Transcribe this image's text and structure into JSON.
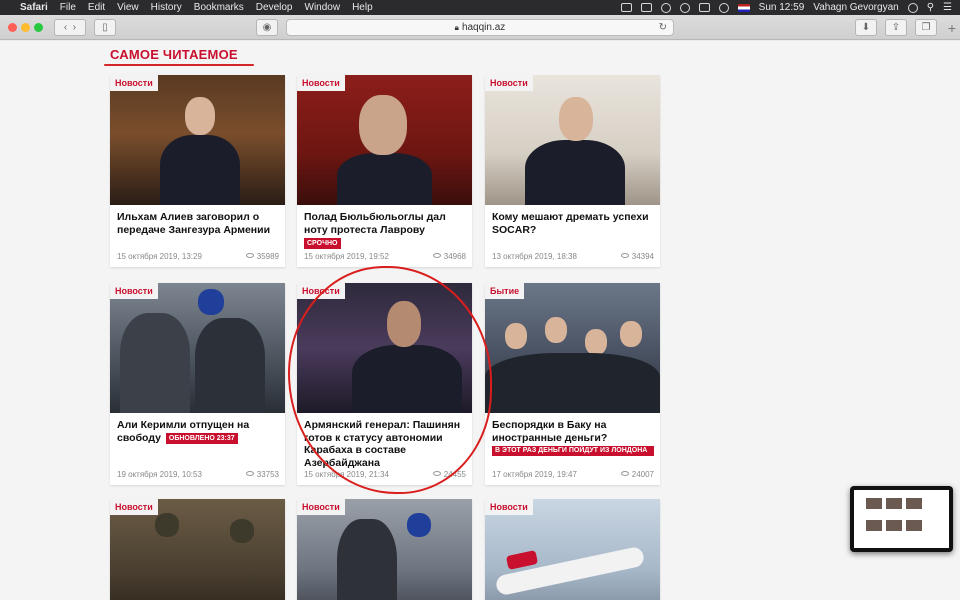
{
  "menubar": {
    "app": "Safari",
    "items": [
      "File",
      "Edit",
      "View",
      "History",
      "Bookmarks",
      "Develop",
      "Window",
      "Help"
    ],
    "clock": "Sun 12:59",
    "user": "Vahagn Gevorgyan"
  },
  "browser": {
    "url": "haqqin.az"
  },
  "section": {
    "title": "САМОЕ ЧИТАЕМОЕ"
  },
  "cards": [
    {
      "category": "Новости",
      "title": "Ильхам Алиев заговорил о передаче Зангезура Армении",
      "tag": "",
      "date": "15 октября 2019, 13:29",
      "views": "35989"
    },
    {
      "category": "Новости",
      "title": "Полад Бюльбюльоглы дал ноту протеста Лаврову",
      "tag": "СРОЧНО",
      "date": "15 октября 2019, 19:52",
      "views": "34968"
    },
    {
      "category": "Новости",
      "title": "Кому мешают дремать успехи SOCAR?",
      "tag": "",
      "date": "13 октября 2019, 18:38",
      "views": "34394"
    },
    {
      "category": "Новости",
      "title": "Али Керимли отпущен на свободу",
      "tag": "ОБНОВЛЕНО 23:37",
      "date": "19 октября 2019, 10:53",
      "views": "33753"
    },
    {
      "category": "Новости",
      "title": "Армянский генерал: Пашинян готов к статусу автономии Карабаха в составе Азербайджана",
      "tag": "",
      "date": "15 октября 2019, 21:34",
      "views": "24455"
    },
    {
      "category": "Бытие",
      "title": "Беспорядки в Баку на иностранные деньги?",
      "tag": "В ЭТОТ РАЗ ДЕНЬГИ ПОЙДУТ ИЗ ЛОНДОНА",
      "date": "17 октября 2019, 19:47",
      "views": "24007"
    },
    {
      "category": "Новости",
      "title": "",
      "tag": "",
      "date": "",
      "views": ""
    },
    {
      "category": "Новости",
      "title": "",
      "tag": "",
      "date": "",
      "views": ""
    },
    {
      "category": "Новости",
      "title": "",
      "tag": "",
      "date": "",
      "views": ""
    }
  ]
}
